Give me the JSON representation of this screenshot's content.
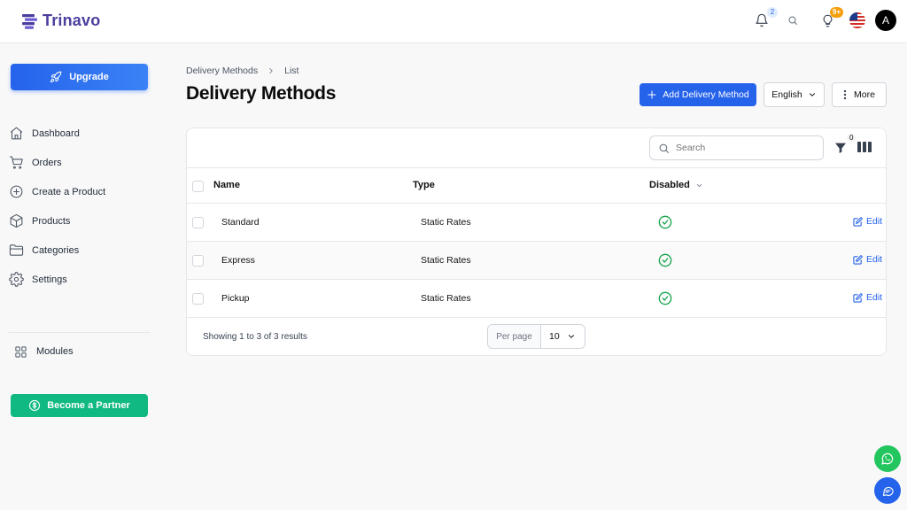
{
  "app": {
    "name": "Trinavo"
  },
  "topbar": {
    "notifications_count": "2",
    "ideas_count": "9+",
    "avatar_initial": "A"
  },
  "sidebar": {
    "upgrade_label": "Upgrade",
    "items": [
      {
        "label": "Dashboard",
        "icon": "home-icon"
      },
      {
        "label": "Orders",
        "icon": "cart-icon"
      },
      {
        "label": "Create a Product",
        "icon": "plus-circle-icon"
      },
      {
        "label": "Products",
        "icon": "box-icon"
      },
      {
        "label": "Categories",
        "icon": "folder-icon"
      },
      {
        "label": "Settings",
        "icon": "gear-icon"
      }
    ],
    "modules_label": "Modules",
    "partner_label": "Become a Partner"
  },
  "breadcrumb": {
    "items": [
      "Delivery Methods",
      "List"
    ]
  },
  "page": {
    "title": "Delivery Methods",
    "add_label": "Add Delivery Method",
    "language": "English",
    "more_label": "More"
  },
  "table": {
    "search_placeholder": "Search",
    "filter_count": "0",
    "columns": {
      "name": "Name",
      "type": "Type",
      "disabled": "Disabled"
    },
    "rows": [
      {
        "name": "Standard",
        "type": "Static Rates",
        "edit": "Edit"
      },
      {
        "name": "Express",
        "type": "Static Rates",
        "edit": "Edit"
      },
      {
        "name": "Pickup",
        "type": "Static Rates",
        "edit": "Edit"
      }
    ],
    "showing": "Showing 1 to 3 of 3 results",
    "per_page_label": "Per page",
    "per_page_value": "10"
  },
  "colors": {
    "primary": "#2563eb",
    "brand": "#4b3f9e",
    "success": "#16a34a",
    "partner": "#10b981"
  }
}
